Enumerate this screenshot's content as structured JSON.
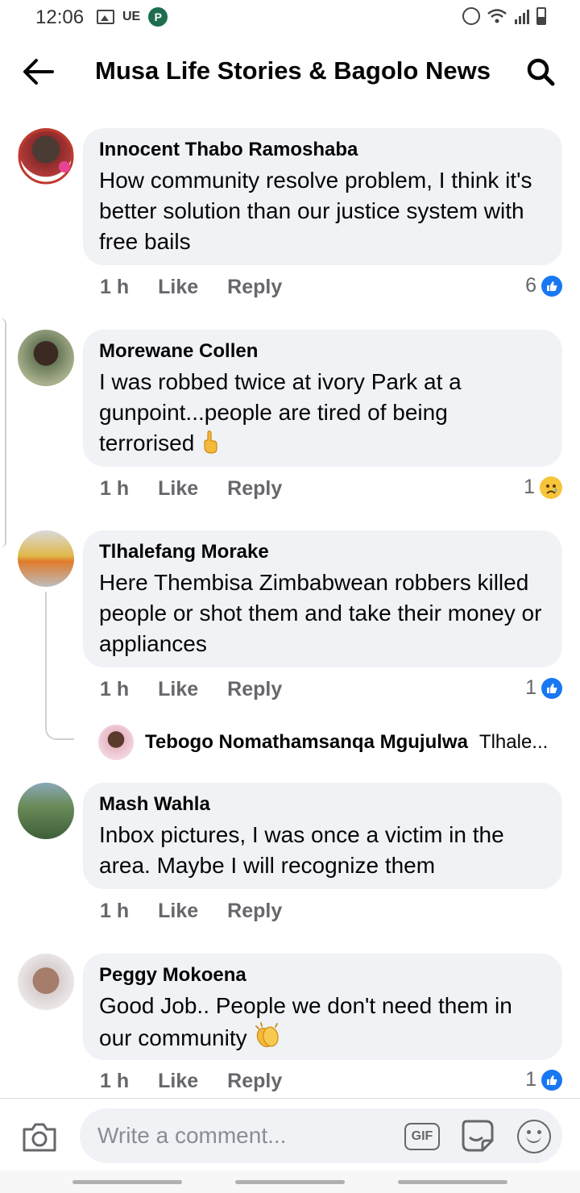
{
  "status_bar": {
    "time": "12:06",
    "carrier": "UE",
    "app_letter": "P"
  },
  "header": {
    "title": "Musa Life Stories & Bagolo News"
  },
  "comments": [
    {
      "author": "Innocent Thabo Ramoshaba",
      "text": "How community resolve problem, I think it's better solution than our justice system with free bails",
      "time": "1 h",
      "like": "Like",
      "reply": "Reply",
      "reaction_count": "6",
      "reaction": "like"
    },
    {
      "author": "Morewane Collen",
      "text": "I was robbed twice at ivory Park at a gunpoint...people are tired of being terrorised",
      "emoji": "fingers-crossed",
      "time": "1 h",
      "like": "Like",
      "reply": "Reply",
      "reaction_count": "1",
      "reaction": "sad"
    },
    {
      "author": "Tlhalefang Morake",
      "text": "Here Thembisa Zimbabwean robbers killed people or shot them and take their money or appliances",
      "time": "1 h",
      "like": "Like",
      "reply": "Reply",
      "reaction_count": "1",
      "reaction": "like",
      "reply_preview": {
        "author": "Tebogo Nomathamsanqa Mgujulwa",
        "text": "Tlhale..."
      }
    },
    {
      "author": "Mash Wahla",
      "text": "Inbox pictures, I was once a victim in the area. Maybe I will recognize them",
      "time": "1 h",
      "like": "Like",
      "reply": "Reply"
    },
    {
      "author": "Peggy Mokoena",
      "text": "Good Job.. People we don't need them in our community",
      "emoji": "clapping-hands",
      "time": "1 h",
      "like": "Like",
      "reply": "Reply",
      "reaction_count": "1",
      "reaction": "like"
    }
  ],
  "composer": {
    "placeholder": "Write a comment...",
    "gif_label": "GIF"
  },
  "colors": {
    "accent": "#1877f2",
    "bubble": "#f0f2f5",
    "meta": "#65676b"
  }
}
